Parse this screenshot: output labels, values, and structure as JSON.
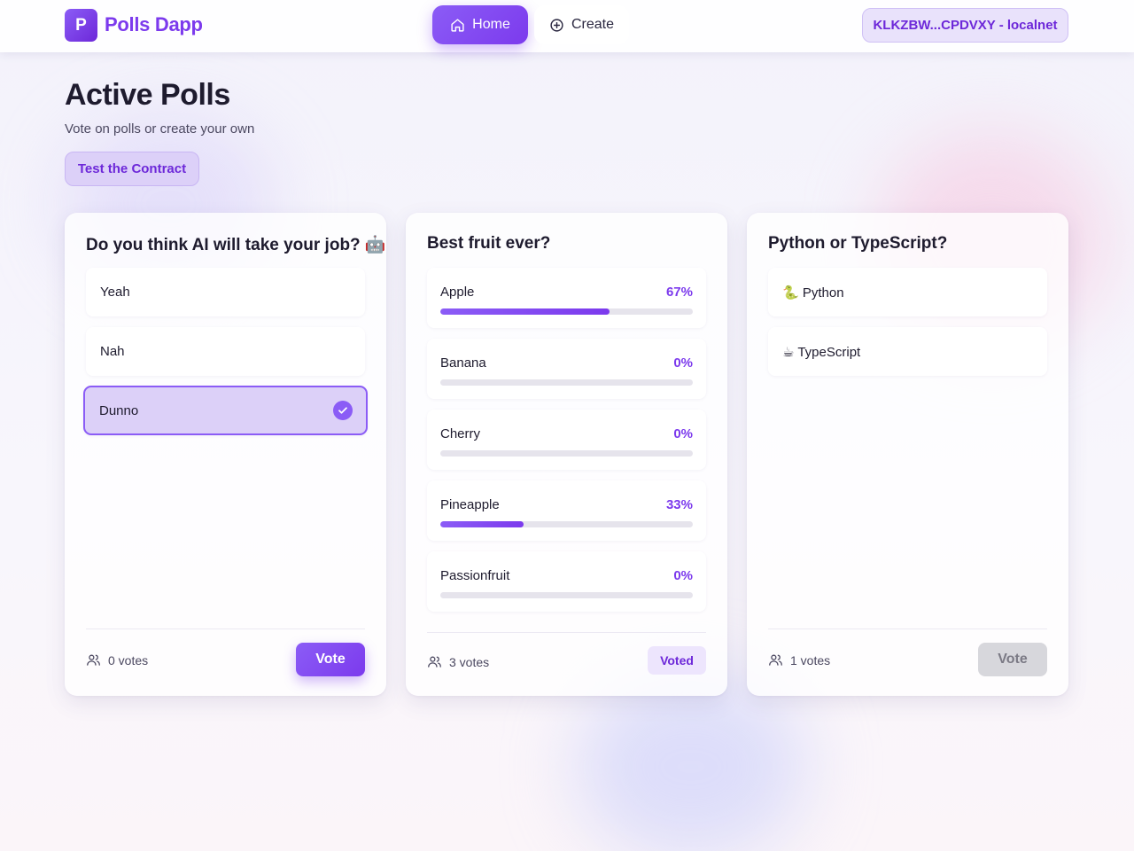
{
  "app": {
    "logo_letter": "P",
    "name": "Polls Dapp"
  },
  "nav": {
    "home": "Home",
    "create": "Create"
  },
  "wallet": {
    "label": "KLKZBW...CPDVXY - localnet"
  },
  "page": {
    "title": "Active Polls",
    "subtitle": "Vote on polls or create your own",
    "test_button": "Test the Contract"
  },
  "colors": {
    "accent": "#7c3aed",
    "accent_light": "#dcd0f8",
    "bar_track": "#e6e4ec"
  },
  "polls": [
    {
      "title": "Do you think AI will take your job? 🤖",
      "options": [
        {
          "label": "Yeah"
        },
        {
          "label": "Nah"
        },
        {
          "label": "Dunno",
          "selected": true
        }
      ],
      "votes": "0 votes",
      "action": "Vote"
    },
    {
      "title": "Best fruit ever?",
      "results": [
        {
          "label": "Apple",
          "pct": "67%",
          "fraction": 0.67
        },
        {
          "label": "Banana",
          "pct": "0%",
          "fraction": 0
        },
        {
          "label": "Cherry",
          "pct": "0%",
          "fraction": 0
        },
        {
          "label": "Pineapple",
          "pct": "33%",
          "fraction": 0.33
        },
        {
          "label": "Passionfruit",
          "pct": "0%",
          "fraction": 0
        }
      ],
      "votes": "3 votes",
      "action": "Voted"
    },
    {
      "title": "Python or TypeScript?",
      "options": [
        {
          "label": "🐍 Python"
        },
        {
          "label": "☕ TypeScript"
        }
      ],
      "votes": "1 votes",
      "action": "Vote"
    }
  ]
}
